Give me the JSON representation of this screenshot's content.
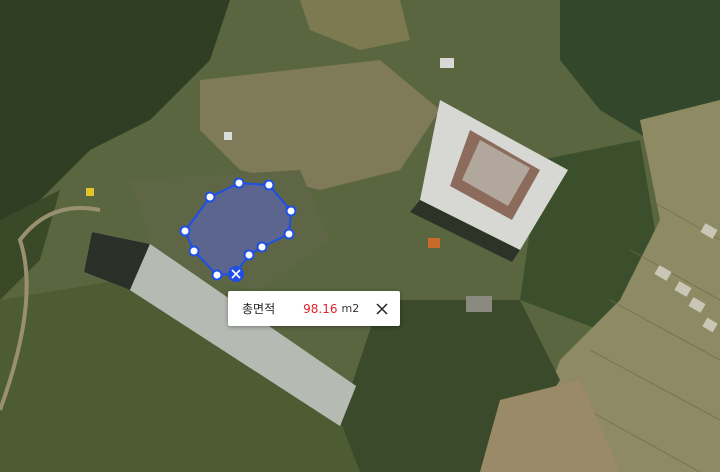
{
  "measure": {
    "label": "총면적",
    "value": "98.16",
    "unit": "m2"
  },
  "icons": {
    "close": "close-icon",
    "delete_vertex": "delete-vertex-icon"
  },
  "colors": {
    "polygon_stroke": "#1e4fe6",
    "polygon_fill": "#5a64c8",
    "value_text": "#e2222a"
  }
}
